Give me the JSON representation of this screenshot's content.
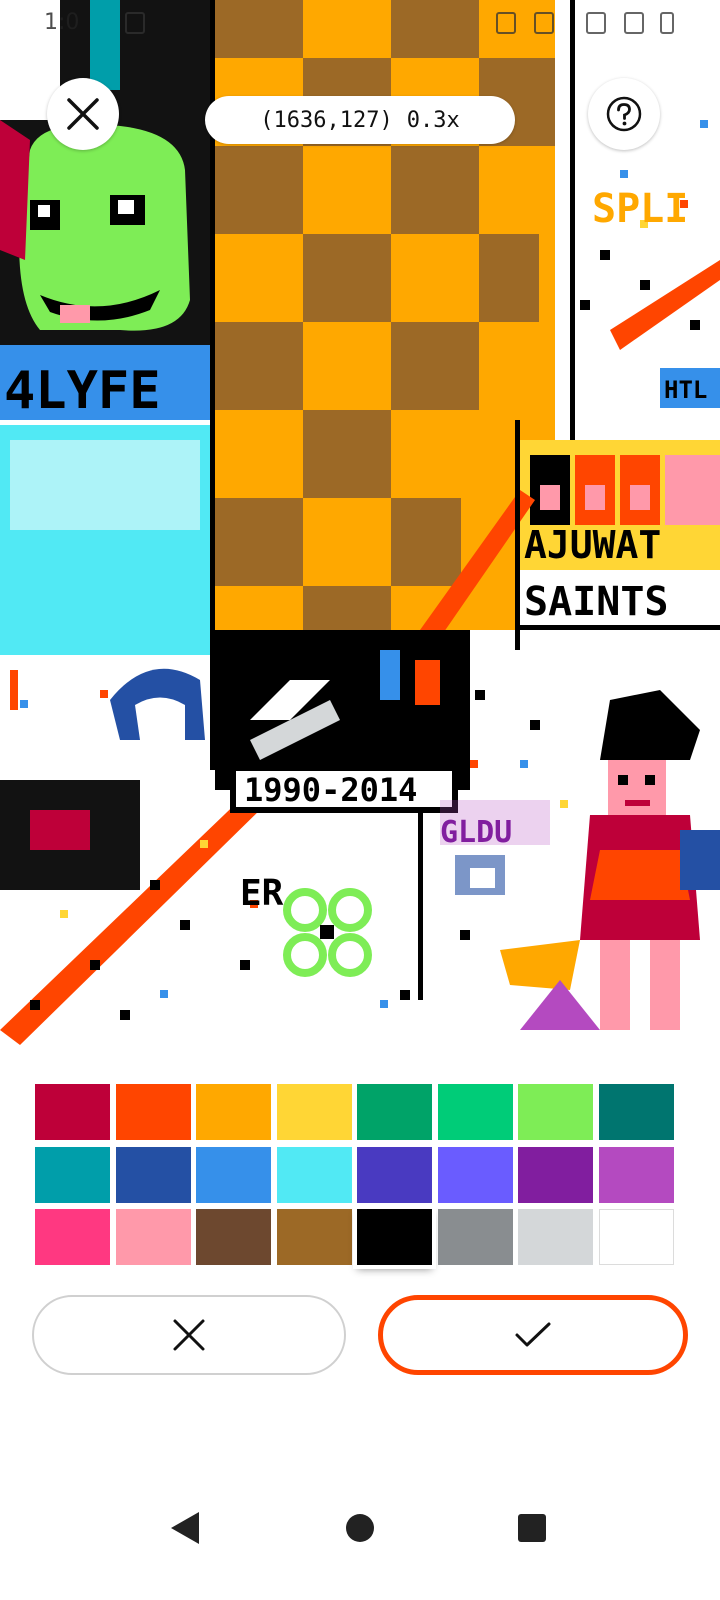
{
  "status_bar": {
    "time": "1:0"
  },
  "canvas": {
    "coordinates": "(1636,127)",
    "zoom": "0.3x",
    "art_text": {
      "lyfe": "4LYFE",
      "years": "1990-2014",
      "ajuwat": "AJUWAT",
      "saints": "SAINTS",
      "split": "SPLI",
      "gldu": "GLDU",
      "er": "ER",
      "htl": "HTL"
    }
  },
  "overlay": {
    "close_icon": "close-icon",
    "help_icon": "help-icon"
  },
  "palette": {
    "selected_index": 20,
    "colors": [
      "#BE0039",
      "#FF4500",
      "#FFA800",
      "#FFD635",
      "#00A368",
      "#00CC78",
      "#7EED56",
      "#00756F",
      "#009EAA",
      "#2450A4",
      "#3690EA",
      "#51E9F4",
      "#493AC1",
      "#6A5CFF",
      "#811E9F",
      "#B44AC0",
      "#FF3881",
      "#FF99AA",
      "#6D482F",
      "#9C6926",
      "#000000",
      "#898D90",
      "#D4D7D9",
      "#FFFFFF"
    ]
  },
  "actions": {
    "cancel_icon": "x-icon",
    "confirm_icon": "check-icon",
    "accent": "#FF4500"
  },
  "nav": {
    "back_icon": "back-triangle-icon",
    "home_icon": "home-circle-icon",
    "recents_icon": "recents-square-icon"
  }
}
